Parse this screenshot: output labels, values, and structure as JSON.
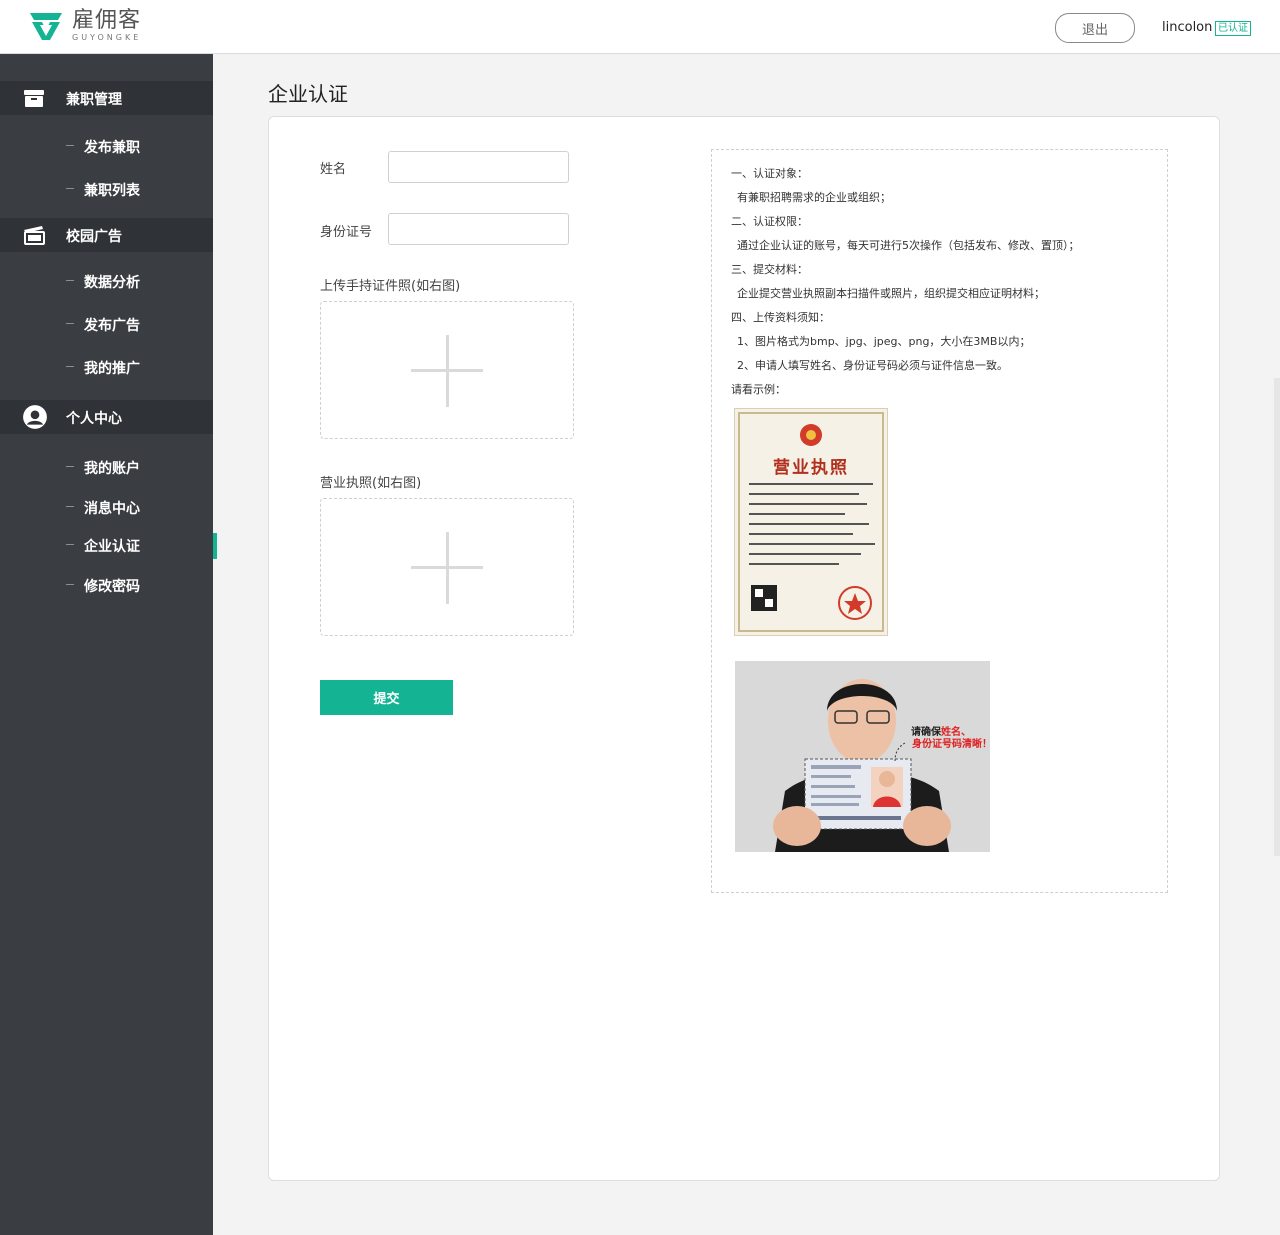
{
  "header": {
    "logo_cn": "雇佣客",
    "logo_en": "GUYONGKE",
    "logout_label": "退出",
    "username": "lincolon",
    "verified_label": "已认证"
  },
  "sidebar": {
    "groups": [
      {
        "label": "兼职管理",
        "icon": "briefcase-icon",
        "items": [
          "发布兼职",
          "兼职列表"
        ]
      },
      {
        "label": "校园广告",
        "icon": "billboard-icon",
        "items": [
          "数据分析",
          "发布广告",
          "我的推广"
        ]
      },
      {
        "label": "个人中心",
        "icon": "user-icon",
        "items": [
          "我的账户",
          "消息中心",
          "企业认证",
          "修改密码"
        ]
      }
    ],
    "active_item": "企业认证"
  },
  "page": {
    "title": "企业认证",
    "form": {
      "name_label": "姓名",
      "name_value": "",
      "id_label": "身份证号",
      "id_value": "",
      "handheld_label": "上传手持证件照(如右图)",
      "license_label": "营业执照(如右图)",
      "submit_label": "提交"
    },
    "info": {
      "lines": [
        "一、认证对象：",
        "有兼职招聘需求的企业或组织；",
        "二、认证权限：",
        "通过企业认证的账号，每天可进行5次操作（包括发布、修改、置顶）；",
        "三、提交材料：",
        "企业提交营业执照副本扫描件或照片，组织提交相应证明材料；",
        "四、上传资料须知：",
        "1、图片格式为bmp、jpg、jpeg、png，大小在3MB以内；",
        "2、申请人填写姓名、身份证号码必须与证件信息一致。",
        "请看示例："
      ],
      "license_title": "营业执照",
      "photo_note_1a": "请确保",
      "photo_note_1b": "姓名、",
      "photo_note_2": "身份证号码清晰！"
    }
  },
  "colors": {
    "accent": "#14b394",
    "sidebar_bg": "#3a3d42",
    "sidebar_head_bg": "#2f3236"
  }
}
